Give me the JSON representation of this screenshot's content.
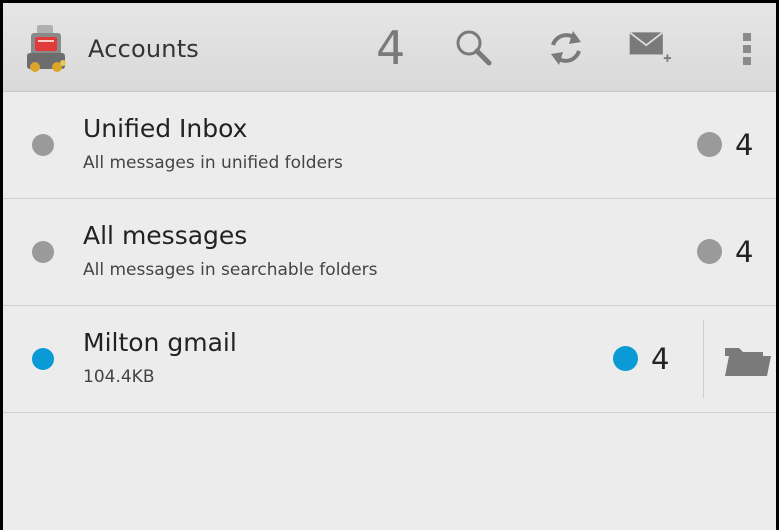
{
  "actionbar": {
    "title": "Accounts",
    "unread_count": "4",
    "icons": [
      "app-icon",
      "search-icon",
      "refresh-icon",
      "compose-icon",
      "overflow-menu-icon"
    ]
  },
  "accounts": [
    {
      "name": "Unified Inbox",
      "description": "All messages in unified folders",
      "unread": "4",
      "status_color": "#9a9a9a"
    },
    {
      "name": "All messages",
      "description": "All messages in searchable folders",
      "unread": "4",
      "status_color": "#9a9a9a"
    },
    {
      "name": "Milton gmail",
      "description": "104.4KB",
      "unread": "4",
      "status_color": "#0a9ad6",
      "folder_icon": "folder-icon"
    }
  ],
  "colors": {
    "background": "#ececec",
    "actionbar": "#dedede",
    "accent": "#0a9ad6",
    "inactive_dot": "#9a9a9a",
    "icon_gray": "#7a7a7a"
  }
}
